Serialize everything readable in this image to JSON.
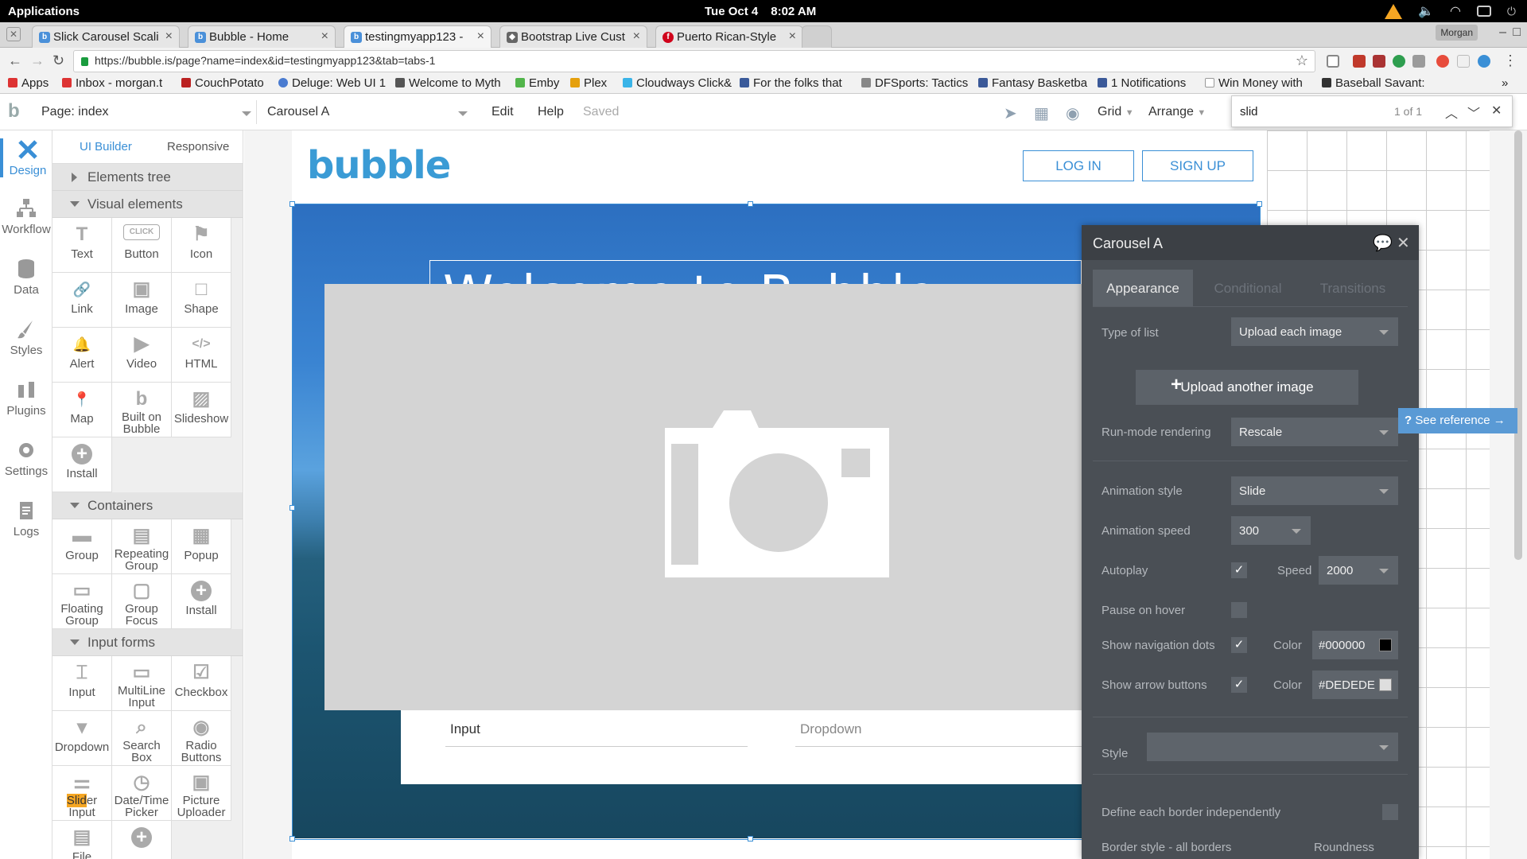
{
  "os": {
    "apps_label": "Applications",
    "date": "Tue Oct  4",
    "time": "8:02 AM"
  },
  "browser": {
    "tabs": [
      {
        "label": "Slick Carousel Scali",
        "favicon": "bubble-favicon",
        "active": false
      },
      {
        "label": "Bubble - Home",
        "favicon": "bubble-favicon",
        "active": false
      },
      {
        "label": "testingmyapp123 -",
        "favicon": "bubble-favicon",
        "active": true
      },
      {
        "label": "Bootstrap Live Cust",
        "favicon": "bootstrap-favicon",
        "active": false
      },
      {
        "label": "Puerto Rican-Style",
        "favicon": "food-favicon",
        "active": false
      }
    ],
    "profile": "Morgan",
    "url": "https://bubble.is/page?name=index&id=testingmyapp123&tab=tabs-1",
    "bookmarks": [
      "Apps",
      "Inbox - morgan.t",
      "CouchPotato",
      "Deluge: Web UI 1",
      "Welcome to Myth",
      "Emby",
      "Plex",
      "Cloudways Click&",
      "For the folks that",
      "DFSports: Tactics",
      "Fantasy Basketba",
      "1 Notifications",
      "Win Money with",
      "Baseball Savant:"
    ],
    "more_bookmarks": "»"
  },
  "editor": {
    "page_label": "Page: index",
    "element_label": "Carousel A",
    "menu": [
      "Edit",
      "Help"
    ],
    "status": "Saved",
    "grid_label": "Grid",
    "arrange_label": "Arrange",
    "find": {
      "query": "slid",
      "count": "1 of 1"
    }
  },
  "rail": [
    {
      "label": "Design",
      "icon": "design-icon",
      "active": true
    },
    {
      "label": "Workflow",
      "icon": "workflow-icon",
      "active": false
    },
    {
      "label": "Data",
      "icon": "data-icon",
      "active": false
    },
    {
      "label": "Styles",
      "icon": "styles-icon",
      "active": false
    },
    {
      "label": "Plugins",
      "icon": "plugins-icon",
      "active": false
    },
    {
      "label": "Settings",
      "icon": "settings-icon",
      "active": false
    },
    {
      "label": "Logs",
      "icon": "logs-icon",
      "active": false
    }
  ],
  "palette": {
    "tabs": [
      "UI Builder",
      "Responsive"
    ],
    "sections": {
      "elements_tree": "Elements tree",
      "visual": "Visual elements",
      "containers": "Containers",
      "inputs": "Input forms"
    },
    "visual_items": [
      {
        "label": "Text",
        "glyph": "T"
      },
      {
        "label": "Button",
        "glyph": "CLICK"
      },
      {
        "label": "Icon",
        "glyph": "⚑"
      },
      {
        "label": "Link",
        "glyph": "🔗"
      },
      {
        "label": "Image",
        "glyph": "▣"
      },
      {
        "label": "Shape",
        "glyph": "□"
      },
      {
        "label": "Alert",
        "glyph": "🔔"
      },
      {
        "label": "Video",
        "glyph": "▶"
      },
      {
        "label": "HTML",
        "glyph": "</>"
      },
      {
        "label": "Map",
        "glyph": "📍"
      },
      {
        "label": "Built on Bubble",
        "glyph": "b"
      },
      {
        "label": "Slideshow",
        "glyph": "▨"
      },
      {
        "label": "Install",
        "glyph": "+"
      }
    ],
    "container_items": [
      {
        "label": "Group",
        "glyph": "▬"
      },
      {
        "label": "Repeating Group",
        "glyph": "▤"
      },
      {
        "label": "Popup",
        "glyph": "▦"
      },
      {
        "label": "Floating Group",
        "glyph": "▭"
      },
      {
        "label": "Group Focus",
        "glyph": "▢"
      },
      {
        "label": "Install",
        "glyph": "+"
      }
    ],
    "input_items": [
      {
        "label": "Input",
        "glyph": "⌶"
      },
      {
        "label": "MultiLine Input",
        "glyph": "▭"
      },
      {
        "label": "Checkbox",
        "glyph": "☑"
      },
      {
        "label": "Dropdown",
        "glyph": "▾"
      },
      {
        "label": "Search Box",
        "glyph": "⌕"
      },
      {
        "label": "Radio Buttons",
        "glyph": "◉"
      },
      {
        "label_hl": "Slid",
        "label_rest": "er",
        "label_line2": "Input",
        "glyph": "⚌"
      },
      {
        "label": "Date/Time Picker",
        "glyph": "◷"
      },
      {
        "label": "Picture Uploader",
        "glyph": "▣"
      },
      {
        "label": "File",
        "glyph": "▤"
      },
      {
        "label": "",
        "glyph": "+"
      }
    ]
  },
  "canvas": {
    "logo": "bubble",
    "login": "LOG IN",
    "signup": "SIGN UP",
    "welcome": "Welcome to Bubble",
    "input_label": "Input",
    "dropdown_label": "Dropdown"
  },
  "panel": {
    "title": "Carousel A",
    "tabs": [
      "Appearance",
      "Conditional",
      "Transitions"
    ],
    "type_of_list_label": "Type of list",
    "type_of_list": "Upload each image",
    "upload_btn": "Upload another image",
    "run_mode_label": "Run-mode rendering",
    "run_mode": "Rescale",
    "see_reference": "See reference →",
    "animation_style_label": "Animation style",
    "animation_style": "Slide",
    "animation_speed_label": "Animation speed",
    "animation_speed": "300",
    "autoplay_label": "Autoplay",
    "autoplay_checked": true,
    "speed_label": "Speed",
    "speed": "2000",
    "pause_label": "Pause on hover",
    "pause_checked": false,
    "nav_dots_label": "Show navigation dots",
    "nav_dots_checked": true,
    "color_label": "Color",
    "nav_dots_color": "#000000",
    "arrows_label": "Show arrow buttons",
    "arrows_checked": true,
    "arrows_color": "#DEDEDE",
    "style_label": "Style",
    "style_value": "",
    "border_indep_label": "Define each border independently",
    "border_style_label": "Border style - all borders",
    "roundness_label": "Roundness"
  },
  "colors": {
    "accent": "#3a8fd6",
    "panel_bg": "#4a4f55",
    "find_highlight": "#f5a623"
  }
}
